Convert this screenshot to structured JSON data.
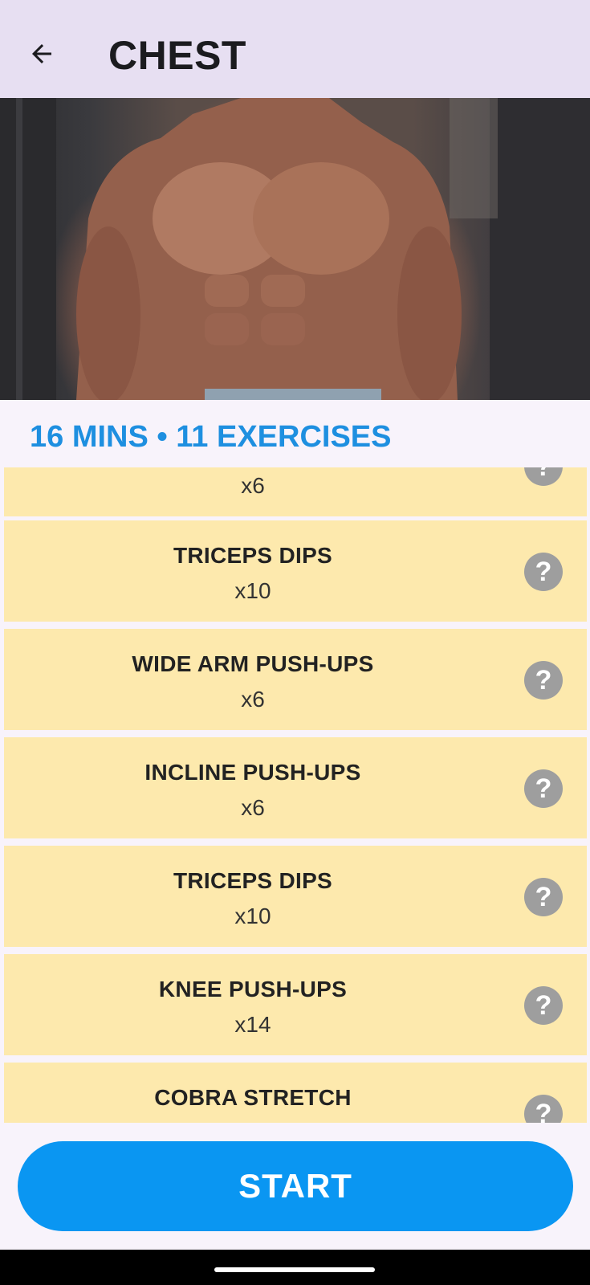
{
  "header": {
    "title": "CHEST",
    "back_icon": "arrow-left-icon"
  },
  "hero": {
    "image_subject": "muscular-torso-photo"
  },
  "summary": {
    "text": "16 MINS • 11 EXERCISES"
  },
  "exercises": [
    {
      "name": "",
      "reps": "x6"
    },
    {
      "name": "TRICEPS DIPS",
      "reps": "x10"
    },
    {
      "name": "WIDE ARM PUSH-UPS",
      "reps": "x6"
    },
    {
      "name": "INCLINE PUSH-UPS",
      "reps": "x6"
    },
    {
      "name": "TRICEPS DIPS",
      "reps": "x10"
    },
    {
      "name": "KNEE PUSH-UPS",
      "reps": "x14"
    },
    {
      "name": "COBRA STRETCH",
      "reps": ""
    }
  ],
  "help_icon": "question-mark-icon",
  "help_glyph": "?",
  "start_button": {
    "label": "START"
  },
  "colors": {
    "appbar": "#e7dff2",
    "accent": "#1e8fe0",
    "card": "#fde9ad",
    "button": "#0a96f2",
    "help_icon": "#9e9e9e"
  }
}
